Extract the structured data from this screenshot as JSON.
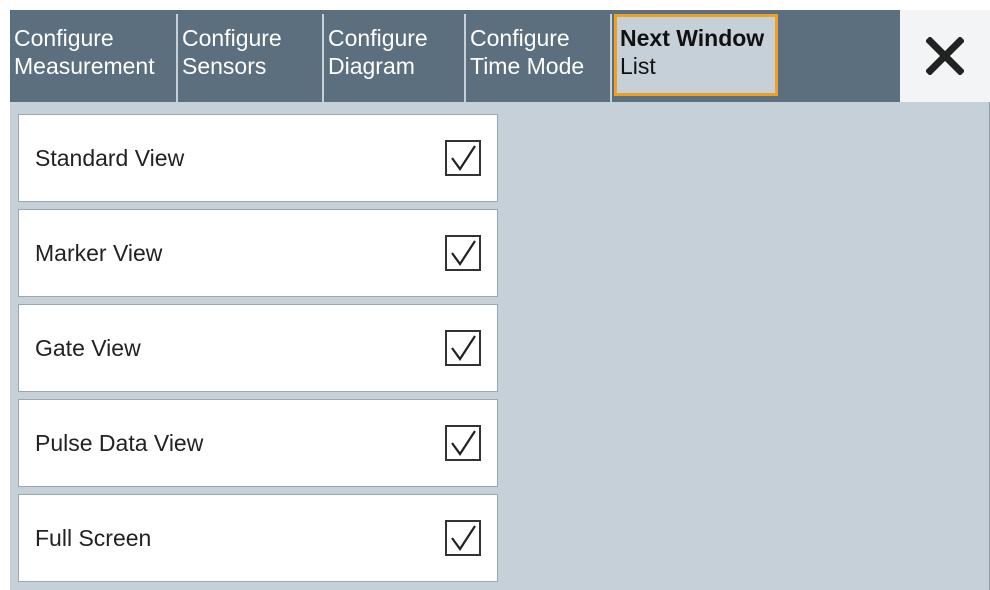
{
  "tabs": [
    {
      "line1": "Configure",
      "line2": "Measurement",
      "active": false
    },
    {
      "line1": "Configure",
      "line2": "Sensors",
      "active": false
    },
    {
      "line1": "Configure",
      "line2": "Diagram",
      "active": false
    },
    {
      "line1": "Configure",
      "line2": "Time Mode",
      "active": false
    },
    {
      "line1": "Next Window",
      "line2": "List",
      "active": true
    }
  ],
  "close_icon": "close-icon",
  "views": [
    {
      "label": "Standard View",
      "checked": true
    },
    {
      "label": "Marker View",
      "checked": true
    },
    {
      "label": "Gate View",
      "checked": true
    },
    {
      "label": "Pulse Data View",
      "checked": true
    },
    {
      "label": "Full Screen",
      "checked": true
    }
  ],
  "colors": {
    "tabbar": "#5b6f7e",
    "panel": "#c5d0d8",
    "active_border": "#f0a020"
  }
}
